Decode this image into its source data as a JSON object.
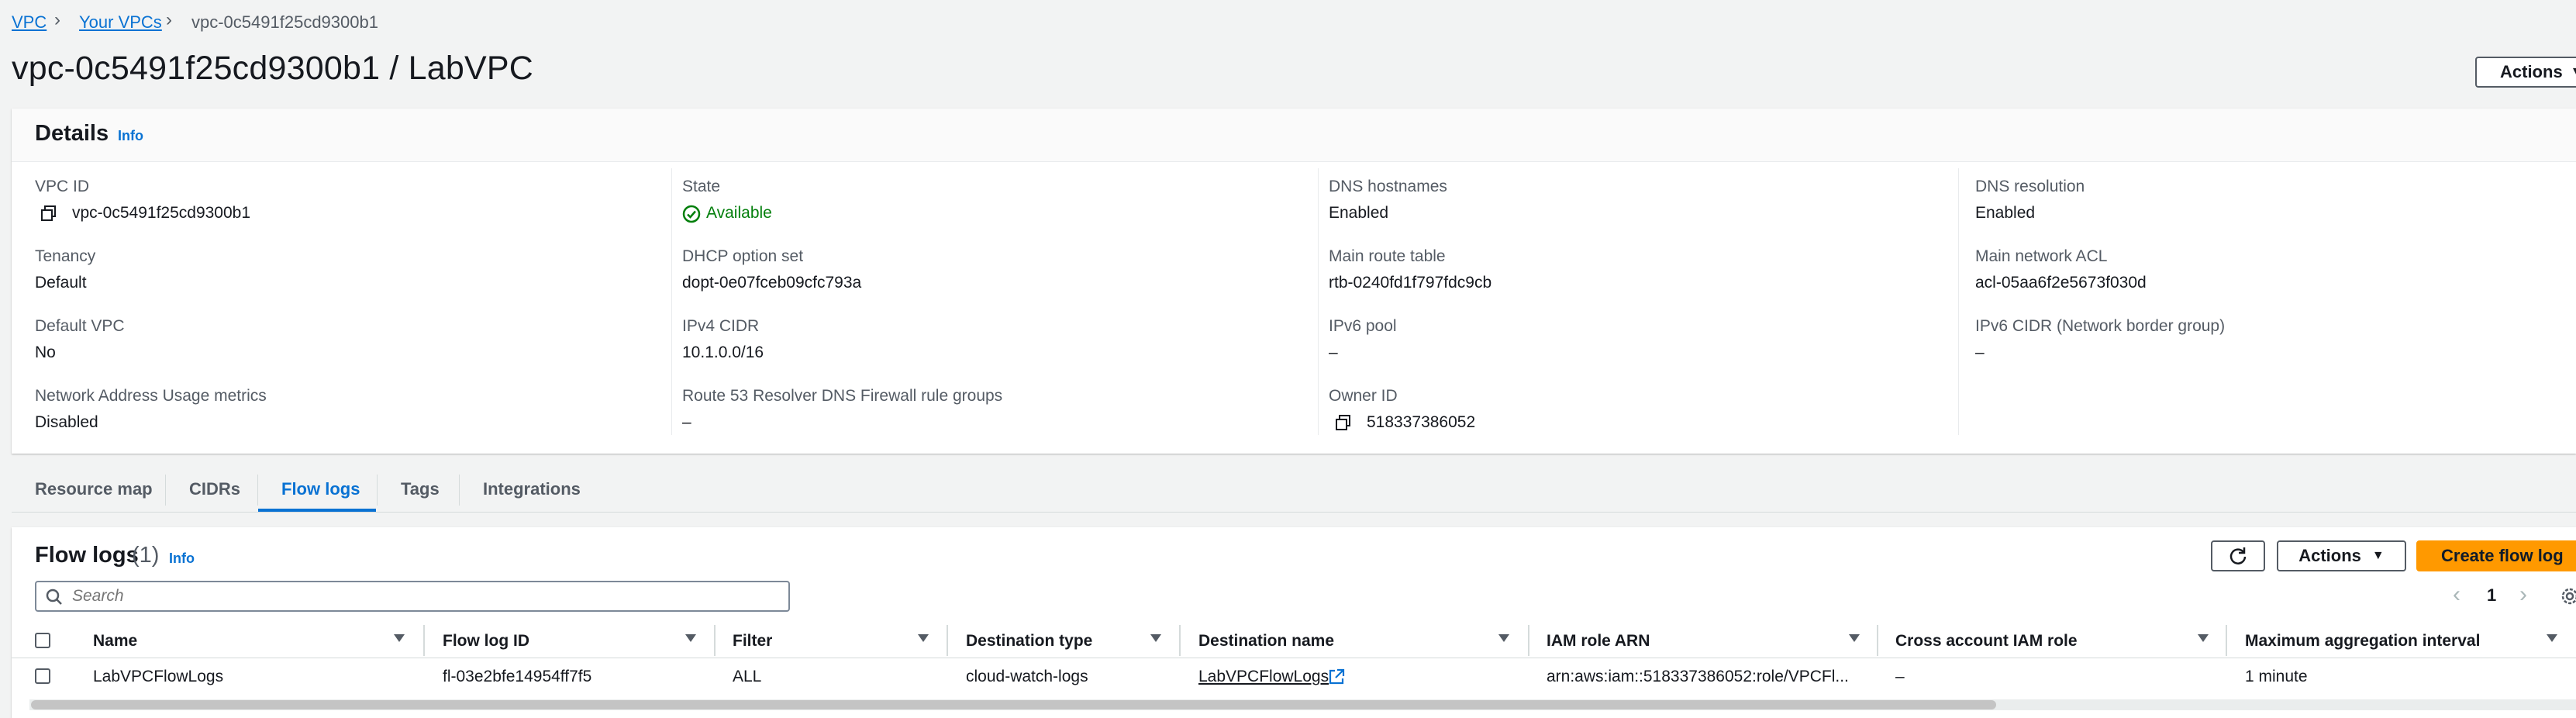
{
  "breadcrumb": {
    "root": "VPC",
    "parent": "Your VPCs",
    "current": "vpc-0c5491f25cd9300b1"
  },
  "page_title": "vpc-0c5491f25cd9300b1 / LabVPC",
  "header_actions_label": "Actions",
  "details": {
    "title": "Details",
    "info": "Info",
    "fields": {
      "vpc_id": {
        "label": "VPC ID",
        "value": "vpc-0c5491f25cd9300b1"
      },
      "state": {
        "label": "State",
        "value": "Available"
      },
      "dns_hostnames": {
        "label": "DNS hostnames",
        "value": "Enabled"
      },
      "dns_resolution": {
        "label": "DNS resolution",
        "value": "Enabled"
      },
      "tenancy": {
        "label": "Tenancy",
        "value": "Default"
      },
      "dhcp": {
        "label": "DHCP option set",
        "value": "dopt-0e07fceb09cfc793a"
      },
      "main_route_table": {
        "label": "Main route table",
        "value": "rtb-0240fd1f797fdc9cb"
      },
      "main_acl": {
        "label": "Main network ACL",
        "value": "acl-05aa6f2e5673f030d"
      },
      "default_vpc": {
        "label": "Default VPC",
        "value": "No"
      },
      "ipv4_cidr": {
        "label": "IPv4 CIDR",
        "value": "10.1.0.0/16"
      },
      "ipv6_pool": {
        "label": "IPv6 pool",
        "value": "–"
      },
      "ipv6_cidr": {
        "label": "IPv6 CIDR (Network border group)",
        "value": "–"
      },
      "nau_metrics": {
        "label": "Network Address Usage metrics",
        "value": "Disabled"
      },
      "route53": {
        "label": "Route 53 Resolver DNS Firewall rule groups",
        "value": "–"
      },
      "owner_id": {
        "label": "Owner ID",
        "value": "518337386052"
      }
    }
  },
  "tabs": [
    "Resource map",
    "CIDRs",
    "Flow logs",
    "Tags",
    "Integrations"
  ],
  "active_tab": "Flow logs",
  "flow_logs": {
    "title": "Flow logs",
    "count": "(1)",
    "info": "Info",
    "actions_label": "Actions",
    "create_label": "Create flow log",
    "search_placeholder": "Search",
    "page_number": "1",
    "columns": [
      "Name",
      "Flow log ID",
      "Filter",
      "Destination type",
      "Destination name",
      "IAM role ARN",
      "Cross account IAM role",
      "Maximum aggregation interval"
    ],
    "rows": [
      [
        "LabVPCFlowLogs",
        "fl-03e2bfe14954ff7f5",
        "ALL",
        "cloud-watch-logs",
        "LabVPCFlowLogs",
        "arn:aws:iam::518337386052:role/VPCFl...",
        "–",
        "1 minute"
      ]
    ]
  },
  "colors": {
    "link": "#0972d3",
    "primary": "#ff9900",
    "success": "#037f0c",
    "text": "#16191f",
    "muted": "#545b64"
  },
  "icons": [
    "chevron-right-icon",
    "copy-icon",
    "status-available-icon",
    "refresh-icon",
    "caret-down-icon",
    "search-icon",
    "chevron-left-icon",
    "settings-icon",
    "external-link-icon",
    "sort-icon"
  ]
}
